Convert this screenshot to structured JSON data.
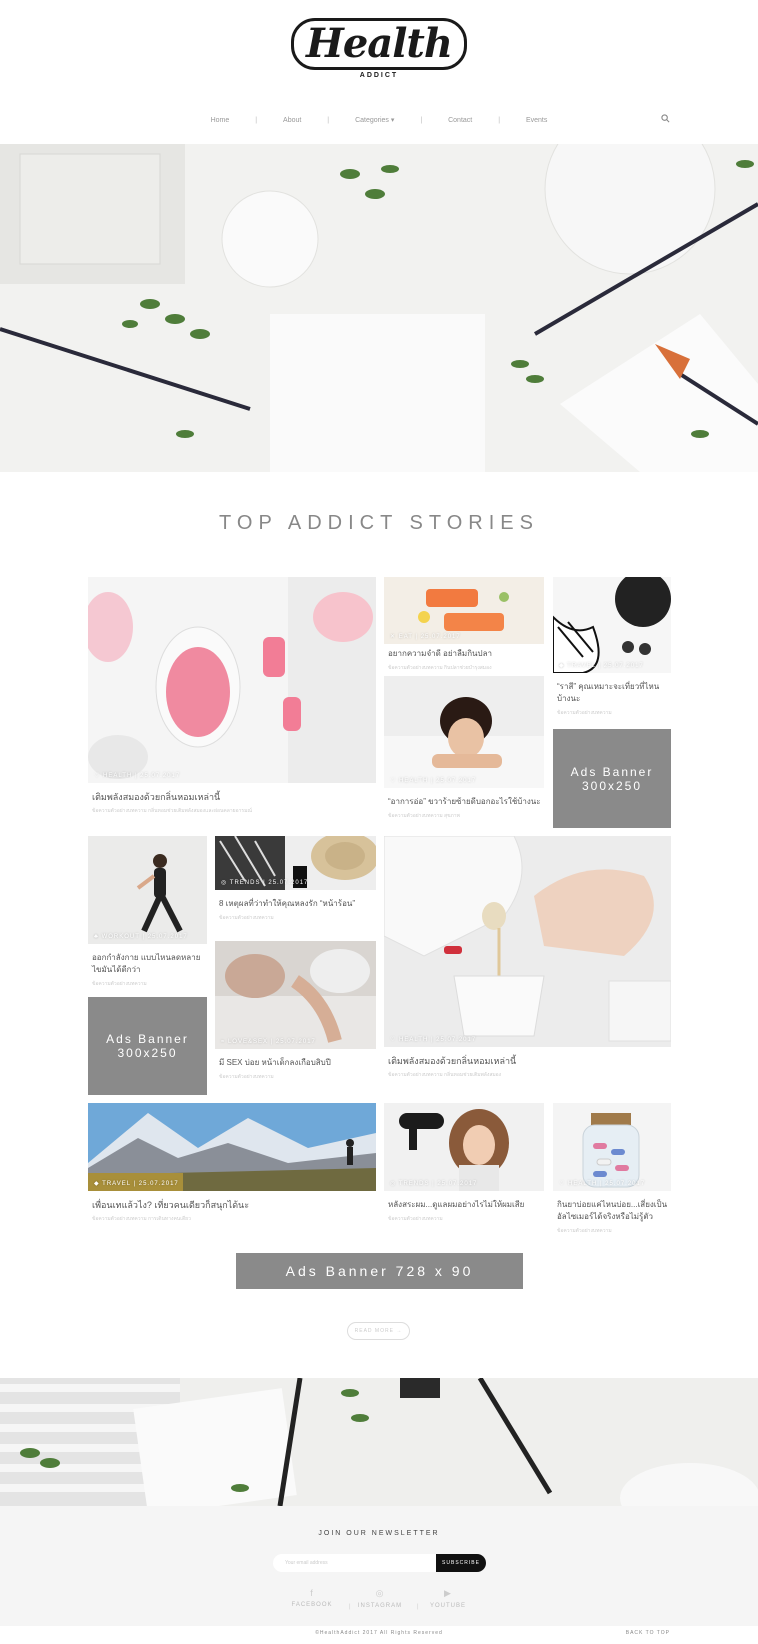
{
  "header": {
    "logo_text": "Health",
    "logo_sub": "ADDICT",
    "nav": [
      "Home",
      "About",
      "Categories ▾",
      "Contact",
      "Events"
    ],
    "nav_sep": "|"
  },
  "section_title": "TOP ADDICT STORIES",
  "cards": [
    {
      "meta": "♡ HEALTH  |  25.07.2017",
      "title": "เติมพลังสมองด้วยกลิ่นหอมเหล่านี้",
      "excerpt": "ข้อความตัวอย่างบทความ กลิ่นหอมช่วยเติมพลังสมองและผ่อนคลายอารมณ์"
    },
    {
      "meta": "✕ EAT  |  25.07.2017",
      "title": "อยากความจำดี อย่าลืมกินปลา",
      "excerpt": "ข้อความตัวอย่างบทความ กินปลาช่วยบำรุงสมอง"
    },
    {
      "meta": "◆ TRAVEL  |  25.07.2017",
      "title": "“ราสี” คุณเหมาะจะเที่ยวที่ไหนบ้างนะ",
      "excerpt": "ข้อความตัวอย่างบทความ"
    },
    {
      "meta": "♡ HEALTH  |  25.07.2017",
      "title": "“อาการอ่อ” ขวาร้ายซ้ายดีบอกอะไรใช้บ้างนะ",
      "excerpt": "ข้อความตัวอย่างบทความ สุขภาพ"
    },
    {
      "meta": "♣ WORKOUT  |  25.07.2017",
      "title": "ออกกำลังกาย แบบไหนลดหลายไขมันได้ดีกว่า",
      "excerpt": "ข้อความตัวอย่างบทความ"
    },
    {
      "meta": "◎ TRENDS  |  25.07.2017",
      "title": "8 เหตุผลที่ว่าทำให้คุณหลงรัก “หน้าร้อน”",
      "excerpt": "ข้อความตัวอย่างบทความ"
    },
    {
      "meta": "≈ LOVE&SEX  |  25.07.2017",
      "title": "มี SEX บ่อย หน้าเด็กลงเกือบสิบปี",
      "excerpt": "ข้อความตัวอย่างบทความ"
    },
    {
      "meta": "♡ HEALTH  |  25.07.2017",
      "title": "เติมพลังสมองด้วยกลิ่นหอมเหล่านี้",
      "excerpt": "ข้อความตัวอย่างบทความ กลิ่นหอมช่วยเติมพลังสมอง"
    },
    {
      "meta": "◆ TRAVEL  |  25.07.2017",
      "title": "เพื่อนเทแล้วไง? เที่ยวคนเดียวก็สนุกได้นะ",
      "excerpt": "ข้อความตัวอย่างบทความ การเดินทางคนเดียว"
    },
    {
      "meta": "◎ TRENDS  |  25.07.2017",
      "title": "หลังสระผม...ดูแลผมอย่างไรไม่ให้ผมเสีย",
      "excerpt": "ข้อความตัวอย่างบทความ"
    },
    {
      "meta": "♡ HEALTH  |  25.07.2017",
      "title": "กินยาบ่อยแค่ไหนบ่อย...เสี่ยงเป็นอัลไซเมอร์ได้จริงหรือไม่รู้ตัว",
      "excerpt": "ข้อความตัวอย่างบทความ"
    }
  ],
  "ads": {
    "box_label_1": "Ads Banner",
    "box_size": "300x250",
    "leader": "Ads Banner 728 x 90"
  },
  "read_more": "READ MORE →",
  "newsletter": {
    "title": "JOIN OUR NEWSLETTER",
    "placeholder": "Your email address",
    "button": "SUBSCRIBE"
  },
  "social": [
    {
      "icon": "facebook-icon",
      "glyph": "f",
      "label": "FACEBOOK"
    },
    {
      "icon": "instagram-icon",
      "glyph": "◎",
      "label": "INSTAGRAM"
    },
    {
      "icon": "youtube-icon",
      "glyph": "▶",
      "label": "YOUTUBE"
    }
  ],
  "copyright": "©HealthAddict 2017 All Rights Reserved",
  "back_to_top": "BACK TO TOP"
}
